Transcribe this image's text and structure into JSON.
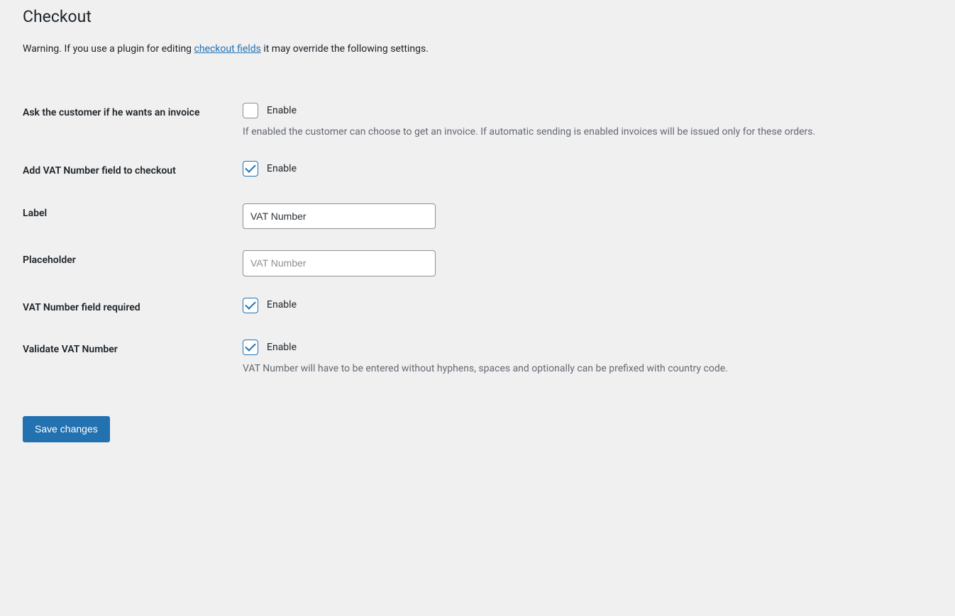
{
  "page": {
    "title": "Checkout",
    "warning_prefix": "Warning. If you use a plugin for editing ",
    "warning_link": "checkout fields",
    "warning_suffix": " it may override the following settings."
  },
  "fields": {
    "ask_invoice": {
      "label": "Ask the customer if he wants an invoice",
      "checkbox_label": "Enable",
      "checked": false,
      "description": "If enabled the customer can choose to get an invoice. If automatic sending is enabled invoices will be issued only for these orders."
    },
    "add_vat": {
      "label": "Add VAT Number field to checkout",
      "checkbox_label": "Enable",
      "checked": true
    },
    "vat_label": {
      "label": "Label",
      "value": "VAT Number"
    },
    "vat_placeholder": {
      "label": "Placeholder",
      "value": "",
      "placeholder": "VAT Number"
    },
    "vat_required": {
      "label": "VAT Number field required",
      "checkbox_label": "Enable",
      "checked": true
    },
    "validate_vat": {
      "label": "Validate VAT Number",
      "checkbox_label": "Enable",
      "checked": true,
      "description": "VAT Number will have to be entered without hyphens, spaces and optionally can be prefixed with country code."
    }
  },
  "submit": {
    "label": "Save changes"
  }
}
